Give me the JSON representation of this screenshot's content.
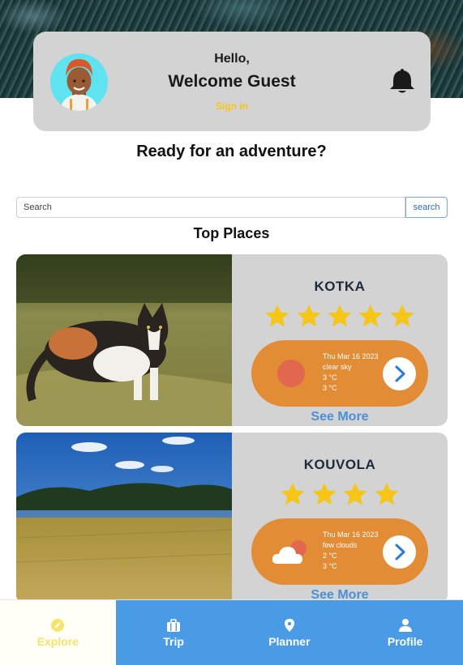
{
  "header": {
    "hello": "Hello,",
    "welcome": "Welcome Guest",
    "signin": "Sign in"
  },
  "main": {
    "headline": "Ready for an adventure?",
    "search": {
      "placeholder": "Search",
      "value": "",
      "button_label": "search"
    },
    "section_title": "Top Places"
  },
  "places": [
    {
      "name": "KOTKA",
      "stars": 5,
      "weather": {
        "date": "Thu Mar 16 2023",
        "description": "clear sky",
        "temp1": "3 °C",
        "temp2": "3 °C",
        "icon": "sun-icon"
      },
      "see_more": "See More"
    },
    {
      "name": "KOUVOLA",
      "stars": 4,
      "weather": {
        "date": "Thu Mar 16 2023",
        "description": "few clouds",
        "temp1": "2 °C",
        "temp2": "3 °C",
        "icon": "cloud-sun-icon"
      },
      "see_more": "See More"
    }
  ],
  "nav": {
    "items": [
      {
        "label": "Explore",
        "icon": "compass-icon",
        "active": true
      },
      {
        "label": "Trip",
        "icon": "briefcase-icon",
        "active": false
      },
      {
        "label": "Planner",
        "icon": "map-pin-icon",
        "active": false
      },
      {
        "label": "Profile",
        "icon": "user-icon",
        "active": false
      }
    ]
  },
  "colors": {
    "accent_yellow": "#f5c518",
    "weather_orange": "#e38c36",
    "nav_blue": "#4a9be6",
    "link_blue": "#4a90d9",
    "card_gray": "#d3d3d3",
    "star_yellow": "#f5c518"
  }
}
